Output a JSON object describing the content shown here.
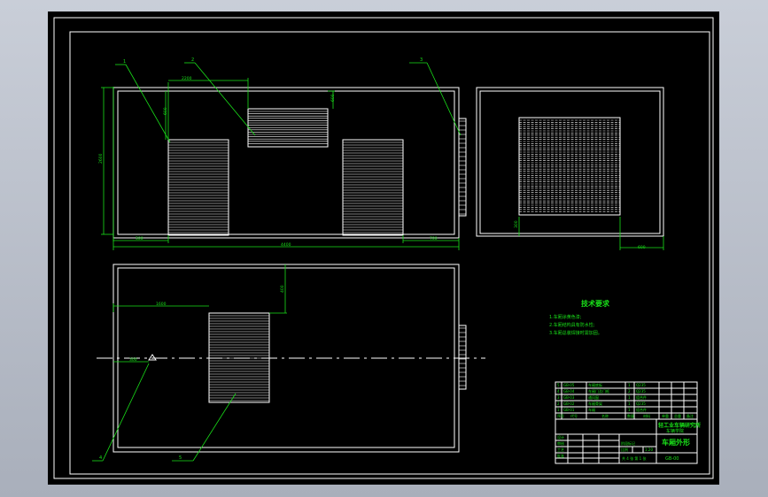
{
  "drawing": {
    "leaders": {
      "l1": "1",
      "l2": "2",
      "l3": "3",
      "l4": "4",
      "l5": "5"
    },
    "dims": {
      "d_top": "2200",
      "d_h1": "600",
      "d_h2": "600",
      "d_left_v": "2600",
      "d_btm_l": "500",
      "d_btm_r": "700",
      "d_total": "4400",
      "d_side_r": "600",
      "d_side_l": "300",
      "d_plan_top": "1600",
      "d_plan_v": "400",
      "d_plan_l": "300"
    },
    "notes": {
      "title": "技术要求",
      "items": [
        "1.车厢涂黄色漆;",
        "2.车厢结构具有防水性;",
        "3.车厢总装焊接时需加固。"
      ]
    },
    "title_block": {
      "part_rows": [
        [
          "5",
          "GB-05",
          "车厢底板",
          "1",
          "Q235"
        ],
        [
          "4",
          "GB-04",
          "车厢门及门框",
          "2",
          "Q235"
        ],
        [
          "3",
          "GB-03",
          "通风窗",
          "1",
          "组合件"
        ],
        [
          "2",
          "GB-02",
          "车厢骨架",
          "1",
          "Q235"
        ],
        [
          "1",
          "GB-01",
          "车厢",
          "1",
          "组合件"
        ]
      ],
      "headers": [
        "序号",
        "代号",
        "名称",
        "数量",
        "材料",
        "单重",
        "总重",
        "备注"
      ],
      "school": "轻工业车辆研究所",
      "school2": "车辆学院",
      "drawing_title": "车厢外形",
      "drawing_no": "GB-00",
      "scale_label": "比例",
      "scale": "1:20",
      "sheet_info": "共 4 张  第 1 张",
      "sign_labels": [
        "设计",
        "审核",
        "工艺",
        "批准"
      ],
      "stage": "阶段标记"
    }
  }
}
